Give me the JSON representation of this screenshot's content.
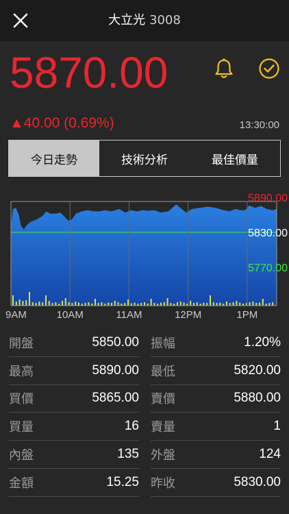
{
  "header": {
    "name": "大立光",
    "code": "3008"
  },
  "quote": {
    "price": "5870.00",
    "change": "▲40.00 (0.69%)",
    "time": "13:30:00"
  },
  "tabs": [
    {
      "label": "今日走勢",
      "active": true
    },
    {
      "label": "技術分析",
      "active": false
    },
    {
      "label": "最佳價量",
      "active": false
    }
  ],
  "colors": {
    "up": "#e8262f",
    "down": "#3ee83e",
    "area": "#1f6fd0",
    "volume": "#e4e23a",
    "reference_line": "#3ee83e"
  },
  "chart_data": {
    "type": "area",
    "y_labels": {
      "high": "5890.00",
      "reference": "5830.00",
      "low": "5770.00"
    },
    "x_tick_labels": [
      "9AM",
      "10AM",
      "11AM",
      "12PM",
      "1PM"
    ],
    "ylim": [
      5770,
      5890
    ],
    "reference": 5830,
    "session_minutes": 270,
    "price_points": [
      [
        0,
        5840
      ],
      [
        2,
        5870
      ],
      [
        5,
        5872
      ],
      [
        8,
        5860
      ],
      [
        10,
        5842
      ],
      [
        13,
        5835
      ],
      [
        16,
        5842
      ],
      [
        20,
        5848
      ],
      [
        26,
        5852
      ],
      [
        32,
        5858
      ],
      [
        36,
        5866
      ],
      [
        40,
        5862
      ],
      [
        46,
        5862
      ],
      [
        50,
        5864
      ],
      [
        54,
        5858
      ],
      [
        58,
        5850
      ],
      [
        62,
        5852
      ],
      [
        66,
        5862
      ],
      [
        72,
        5866
      ],
      [
        78,
        5868
      ],
      [
        84,
        5866
      ],
      [
        90,
        5866
      ],
      [
        96,
        5868
      ],
      [
        102,
        5866
      ],
      [
        110,
        5870
      ],
      [
        116,
        5864
      ],
      [
        122,
        5868
      ],
      [
        128,
        5866
      ],
      [
        134,
        5868
      ],
      [
        140,
        5867
      ],
      [
        146,
        5868
      ],
      [
        152,
        5864
      ],
      [
        160,
        5866
      ],
      [
        168,
        5878
      ],
      [
        172,
        5872
      ],
      [
        178,
        5864
      ],
      [
        184,
        5870
      ],
      [
        192,
        5872
      ],
      [
        200,
        5874
      ],
      [
        208,
        5872
      ],
      [
        216,
        5868
      ],
      [
        222,
        5866
      ],
      [
        228,
        5870
      ],
      [
        234,
        5868
      ],
      [
        238,
        5868
      ],
      [
        242,
        5876
      ],
      [
        248,
        5872
      ],
      [
        254,
        5875
      ],
      [
        260,
        5870
      ],
      [
        266,
        5868
      ],
      [
        270,
        5870
      ]
    ],
    "volumes": [
      30,
      12,
      18,
      14,
      16,
      40,
      10,
      8,
      12,
      9,
      30,
      14,
      8,
      10,
      6,
      14,
      22,
      10,
      8,
      12,
      9,
      6,
      8,
      10,
      6,
      20,
      8,
      10,
      6,
      9,
      8,
      14,
      10,
      6,
      8,
      18,
      7,
      9,
      6,
      8,
      10,
      6,
      20,
      8,
      6,
      9,
      10,
      22,
      8,
      6,
      10,
      12,
      9,
      6,
      14,
      8,
      10,
      6,
      9,
      8,
      30,
      10,
      8,
      9,
      6,
      12,
      8,
      10,
      14,
      9,
      6,
      8,
      10,
      12,
      8,
      9,
      20,
      6,
      8,
      10
    ]
  },
  "stats": [
    {
      "left_label": "開盤",
      "left_value": "5850.00",
      "right_label": "振幅",
      "right_value": "1.20%"
    },
    {
      "left_label": "最高",
      "left_value": "5890.00",
      "right_label": "最低",
      "right_value": "5820.00"
    },
    {
      "left_label": "買價",
      "left_value": "5865.00",
      "right_label": "賣價",
      "right_value": "5880.00"
    },
    {
      "left_label": "買量",
      "left_value": "16",
      "right_label": "賣量",
      "right_value": "1"
    },
    {
      "left_label": "內盤",
      "left_value": "135",
      "right_label": "外盤",
      "right_value": "124"
    },
    {
      "left_label": "金額",
      "left_value": "15.25",
      "right_label": "昨收",
      "right_value": "5830.00"
    }
  ]
}
